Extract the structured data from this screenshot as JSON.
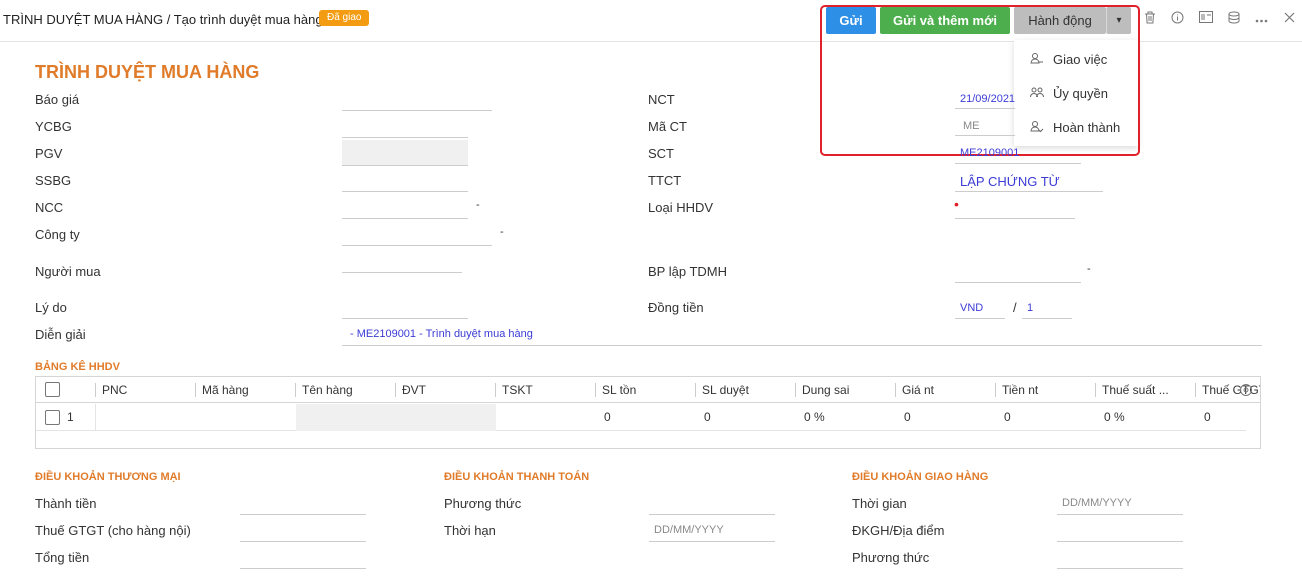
{
  "header": {
    "breadcrumb": "TRÌNH DUYỆT MUA HÀNG / Tạo trình duyệt mua hàng",
    "status_badge": "Đã giao",
    "send_label": "Gửi",
    "send_add_label": "Gửi và thêm mới",
    "actions_label": "Hành động",
    "caret": "▾",
    "icons": [
      "trash-icon",
      "info-icon",
      "card-icon",
      "database-icon",
      "more-icon",
      "close-icon"
    ]
  },
  "actions_menu": [
    {
      "label": "Giao việc",
      "icon": "person-assign-icon"
    },
    {
      "label": "Ủy quyền",
      "icon": "people-icon"
    },
    {
      "label": "Hoàn thành",
      "icon": "person-check-icon"
    }
  ],
  "form": {
    "title": "TRÌNH DUYỆT MUA HÀNG",
    "left_labels": {
      "bao_gia": "Báo giá",
      "ycbg": "YCBG",
      "pgv": "PGV",
      "ssbg": "SSBG",
      "ncc": "NCC",
      "cong_ty": "Công ty",
      "nguoi_mua": "Người mua",
      "ly_do": "Lý do",
      "dien_giai": "Diễn giải"
    },
    "dash": "-",
    "right_labels": {
      "nct": "NCT",
      "ma_ct": "Mã CT",
      "sct": "SCT",
      "ttct": "TTCT",
      "loai_hhdv": "Loại HHDV",
      "bp_lap": "BP lập TDMH",
      "dong_tien": "Đồng tiền"
    },
    "values": {
      "nct": "21/09/2021",
      "ma_ct": "ME",
      "sct": "ME2109001",
      "ttct": "LẬP CHỨNG TỪ",
      "currency": "VND",
      "slash": "/",
      "rate": "1",
      "dien_giai": "- ME2109001 - Trình duyệt mua hàng",
      "required_dot": "•"
    }
  },
  "table": {
    "section_title": "BẢNG KÊ HHDV",
    "columns": [
      "PNC",
      "Mã hàng",
      "Tên hàng",
      "ĐVT",
      "TSKT",
      "SL tồn",
      "SL duyệt",
      "Dung sai",
      "Giá nt",
      "Tiền nt",
      "Thuế suất ...",
      "Thuế GTGT"
    ],
    "row": {
      "index": "1",
      "sl_ton": "0",
      "sl_duyet": "0",
      "dung_sai": "0 %",
      "gia_nt": "0",
      "tien_nt": "0",
      "thue_suat": "0 %",
      "thue_gtgt": "0"
    }
  },
  "terms": {
    "commercial": {
      "title": "ĐIỀU KHOẢN THƯƠNG MẠI",
      "labels": [
        "Thành tiền",
        "Thuế GTGT (cho hàng nội)",
        "Tổng tiền"
      ]
    },
    "payment": {
      "title": "ĐIỀU KHOẢN THANH TOÁN",
      "labels": [
        "Phương thức",
        "Thời hạn"
      ],
      "date_placeholder": "DD/MM/YYYY"
    },
    "delivery": {
      "title": "ĐIỀU KHOẢN GIAO HÀNG",
      "labels": [
        "Thời gian",
        "ĐKGH/Địa điểm",
        "Phương thức"
      ],
      "date_placeholder": "DD/MM/YYYY"
    }
  }
}
